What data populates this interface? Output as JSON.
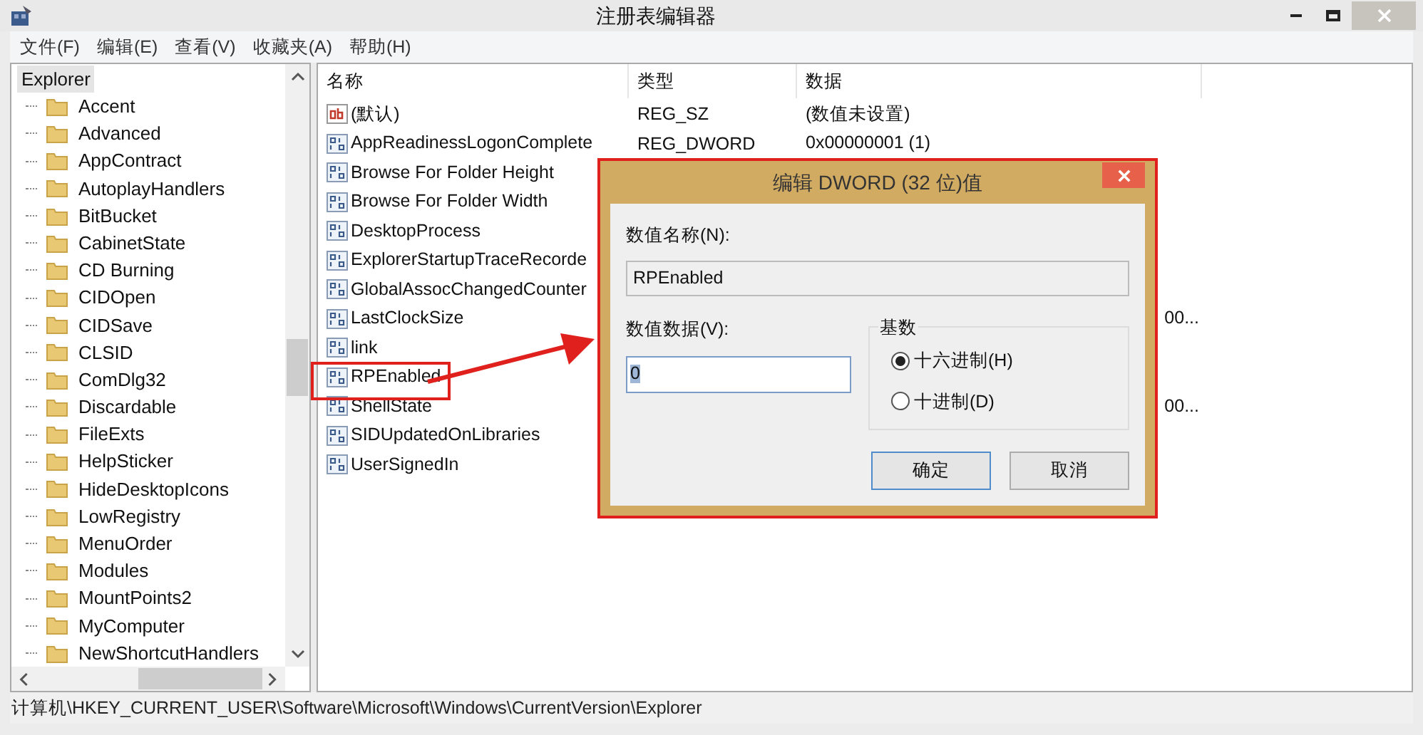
{
  "window": {
    "title": "注册表编辑器"
  },
  "menu": [
    "文件(F)",
    "编辑(E)",
    "查看(V)",
    "收藏夹(A)",
    "帮助(H)"
  ],
  "tree": {
    "items": [
      {
        "label": "Explorer",
        "selected": true,
        "children": [
          {
            "label": "Accent",
            "selected": false
          },
          {
            "label": "Advanced",
            "selected": false
          },
          {
            "label": "AppContract",
            "selected": false
          },
          {
            "label": "AutoplayHandlers",
            "selected": false
          },
          {
            "label": "BitBucket",
            "selected": false
          },
          {
            "label": "CabinetState",
            "selected": false
          },
          {
            "label": "CD Burning",
            "selected": false
          },
          {
            "label": "CIDOpen",
            "selected": false
          },
          {
            "label": "CIDSave",
            "selected": false
          },
          {
            "label": "CLSID",
            "selected": false
          },
          {
            "label": "ComDlg32",
            "selected": false
          },
          {
            "label": "Discardable",
            "selected": false
          },
          {
            "label": "FileExts",
            "selected": false
          },
          {
            "label": "HelpSticker",
            "selected": false
          },
          {
            "label": "HideDesktopIcons",
            "selected": false
          },
          {
            "label": "LowRegistry",
            "selected": false
          },
          {
            "label": "MenuOrder",
            "selected": false
          },
          {
            "label": "Modules",
            "selected": false
          },
          {
            "label": "MountPoints2",
            "selected": false
          },
          {
            "label": "MyComputer",
            "selected": false
          },
          {
            "label": "NewShortcutHandlers",
            "selected": false
          }
        ]
      }
    ]
  },
  "table": {
    "columns": [
      "名称",
      "类型",
      "数据"
    ],
    "rows": [
      {
        "kind": "string",
        "name": "(默认)",
        "type": "REG_SZ",
        "data": "(数值未设置)"
      },
      {
        "kind": "binary",
        "name": "AppReadinessLogonComplete",
        "type": "REG_DWORD",
        "data": "0x00000001 (1)"
      },
      {
        "kind": "binary",
        "name": "Browse For Folder Height"
      },
      {
        "kind": "binary",
        "name": "Browse For Folder Width"
      },
      {
        "kind": "binary",
        "name": "DesktopProcess"
      },
      {
        "kind": "binary",
        "name": "ExplorerStartupTraceRecorde"
      },
      {
        "kind": "binary",
        "name": "GlobalAssocChangedCounter"
      },
      {
        "kind": "binary",
        "name": "LastClockSize",
        "data_tail": "00..."
      },
      {
        "kind": "binary",
        "name": "link"
      },
      {
        "kind": "binary",
        "name": "RPEnabled",
        "highlighted": true
      },
      {
        "kind": "binary",
        "name": "ShellState",
        "data_tail": "00..."
      },
      {
        "kind": "binary",
        "name": "SIDUpdatedOnLibraries"
      },
      {
        "kind": "binary",
        "name": "UserSignedIn"
      }
    ]
  },
  "dialog": {
    "title": "编辑 DWORD (32 位)值",
    "name_label": "数值名称(N):",
    "name_value": "RPEnabled",
    "data_label": "数值数据(V):",
    "data_value": "0",
    "base_label": "基数",
    "radios": [
      {
        "label": "十六进制(H)",
        "selected": true
      },
      {
        "label": "十进制(D)",
        "selected": false
      }
    ],
    "buttons": [
      {
        "label": "确定",
        "default": true
      },
      {
        "label": "取消",
        "default": false
      }
    ]
  },
  "status_bar": "计算机\\HKEY_CURRENT_USER\\Software\\Microsoft\\Windows\\CurrentVersion\\Explorer"
}
